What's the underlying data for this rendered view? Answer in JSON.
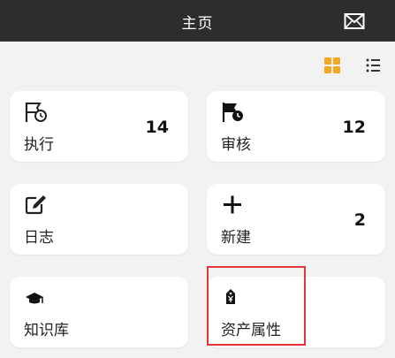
{
  "header": {
    "title": "主页",
    "mail_icon": "mail-icon"
  },
  "view_toggle": {
    "grid_icon": "grid-view-icon",
    "list_icon": "list-view-icon",
    "accent": "#f5a623"
  },
  "cards": [
    {
      "label": "执行",
      "count": "14",
      "icon": "flag-clock-icon"
    },
    {
      "label": "审核",
      "count": "12",
      "icon": "flag-clock-filled-icon"
    },
    {
      "label": "日志",
      "count": "",
      "icon": "edit-icon"
    },
    {
      "label": "新建",
      "count": "2",
      "icon": "plus-icon"
    },
    {
      "label": "知识库",
      "count": "",
      "icon": "graduation-cap-icon"
    },
    {
      "label": "资产属性",
      "count": "",
      "icon": "price-tag-icon"
    }
  ],
  "highlight_color": "#e0373a"
}
